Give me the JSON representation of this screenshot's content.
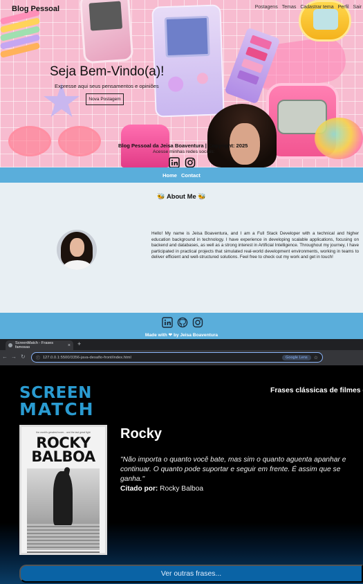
{
  "blog": {
    "brand": "Blog Pessoal",
    "nav": [
      "Postagens",
      "Temas",
      "Cadastrar tema",
      "Perfil",
      "Sair"
    ],
    "hero": {
      "title": "Seja Bem-Vindo(a)!",
      "subtitle": "Expresse aqui seus pensamentos e opiniões",
      "button": "Nova Postagem",
      "copyright": "Blog Pessoal da Jeisa Boaventura | Copyright: 2025",
      "social_text": "Acesse minhas redes sociais:",
      "icons": [
        "linkedin-icon",
        "instagram-icon"
      ]
    },
    "topbar": {
      "home": "Home",
      "contact": "Contact"
    },
    "about": {
      "title": "🐝 About Me 🐝",
      "text": "Hello! My name is Jeisa Boaventura, and I am a Full Stack Developer with a technical and higher education background in technology. I have experience in developing scalable applications, focusing on backend and databases, as well as a strong interest in Artificial Intelligence. Throughout my journey, I have participated in practical projects that simulated real-world development environments, working in teams to deliver efficient and well-structured solutions. Feel free to check out my work and get in touch!"
    },
    "footer": {
      "icons": [
        "linkedin-icon",
        "github-icon",
        "instagram-icon"
      ],
      "made_with": "Made with ❤ by Jeisa Boaventura"
    }
  },
  "browser": {
    "tab_title": "ScreenMatch - Frases famosas",
    "url": "127.0.0.1:5500/3356-java-desafio-front/index.html",
    "lens_label": "Google Lens"
  },
  "screenmatch": {
    "logo_line1": "SCREEN",
    "logo_line2": "MATCH",
    "header": "Frases clássicas de filmes e",
    "poster": {
      "tagline": "the world's greatest boxer... and the last great fight",
      "title_line1": "ROCKY",
      "title_line2": "BALBOA"
    },
    "title": "Rocky",
    "quote": "\"Não importa o quanto você bate, mas sim o quanto aguenta apanhar e continuar. O quanto pode suportar e seguir em frente. É assim que se ganha.\"",
    "cite_label": "Citado por:",
    "cite_name": "Rocky Balboa",
    "button": "Ver outras frases...",
    "colors": {
      "accent": "#2a9bd1",
      "button": "#0a63a5"
    }
  }
}
